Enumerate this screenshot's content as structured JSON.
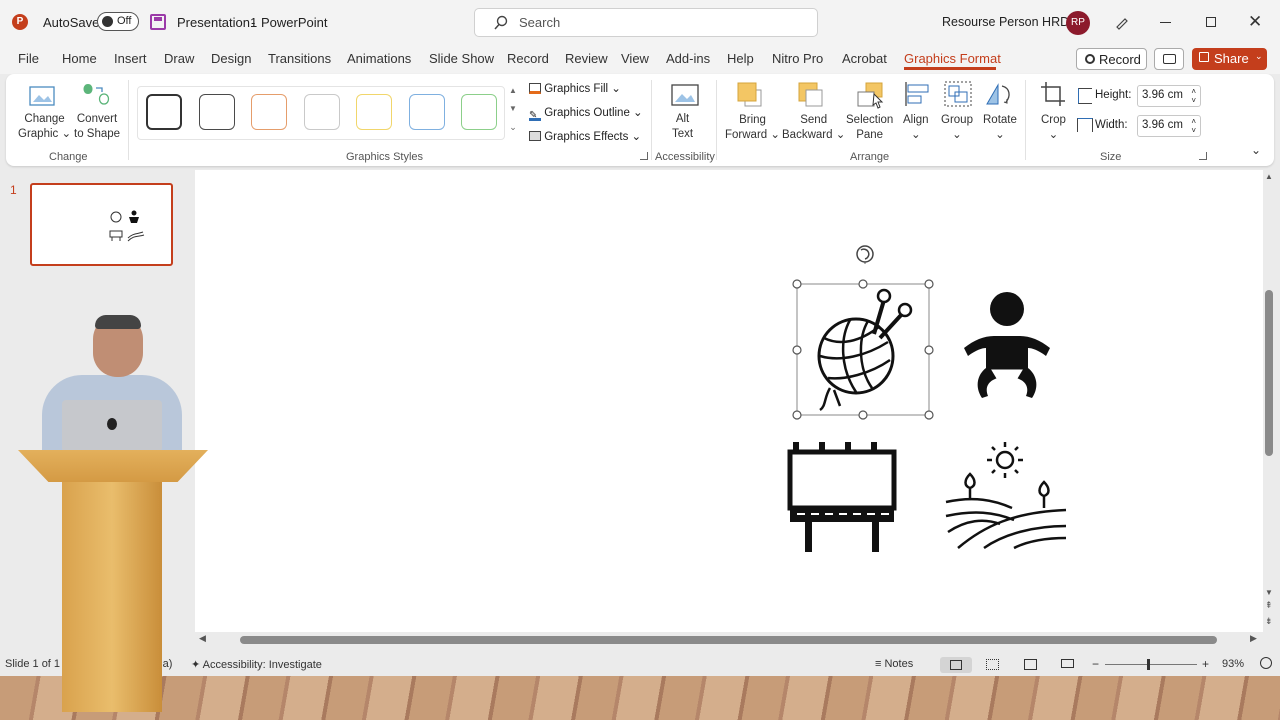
{
  "window": {
    "app_icon": "P",
    "autosave_label": "AutoSave",
    "autosave_state": "Off",
    "save_icon": "save-icon",
    "file_name": "Presentation1",
    "separator": "-",
    "app_name": "PowerPoint",
    "search_placeholder": "Search",
    "user_name": "Resourse Person HRDC",
    "user_initials": "RP"
  },
  "tabs": [
    "File",
    "Home",
    "Insert",
    "Draw",
    "Design",
    "Transitions",
    "Animations",
    "Slide Show",
    "Record",
    "Review",
    "View",
    "Add-ins",
    "Help",
    "Nitro Pro",
    "Acrobat",
    "Graphics Format"
  ],
  "active_tab": "Graphics Format",
  "record_button": "Record",
  "share_button": "Share",
  "ribbon": {
    "change_graphic": [
      "Change",
      "Graphic"
    ],
    "convert_to_shape": [
      "Convert",
      "to Shape"
    ],
    "group_change": "Change",
    "graphics_fill": "Graphics Fill",
    "graphics_outline": "Graphics Outline",
    "graphics_effects": "Graphics Effects",
    "group_styles": "Graphics Styles",
    "alt_text": [
      "Alt",
      "Text"
    ],
    "group_accessibility": "Accessibility",
    "bring_forward": [
      "Bring",
      "Forward"
    ],
    "send_backward": [
      "Send",
      "Backward"
    ],
    "selection_pane": [
      "Selection",
      "Pane"
    ],
    "align": "Align",
    "group_btn": "Group",
    "rotate": "Rotate",
    "group_arrange": "Arrange",
    "crop": "Crop",
    "height_label": "Height:",
    "height_value": "3.96 cm",
    "width_label": "Width:",
    "width_value": "3.96 cm",
    "group_size": "Size"
  },
  "style_colors": [
    "#333333",
    "#4a4a4a",
    "#e59d6b",
    "#c9c9c9",
    "#f1d66b",
    "#7fb0e0",
    "#8ccf8a"
  ],
  "slide_number": "1",
  "status": {
    "slide_info": "Slide 1 of 1",
    "language": "ndia)",
    "accessibility": "Accessibility: Investigate",
    "notes": "Notes",
    "zoom": "93%"
  },
  "icons": {
    "selected": "yarn-ball-icon",
    "baby": "baby-icon",
    "billboard": "billboard-icon",
    "farm": "farm-field-icon"
  },
  "accent": "#c43e1c"
}
